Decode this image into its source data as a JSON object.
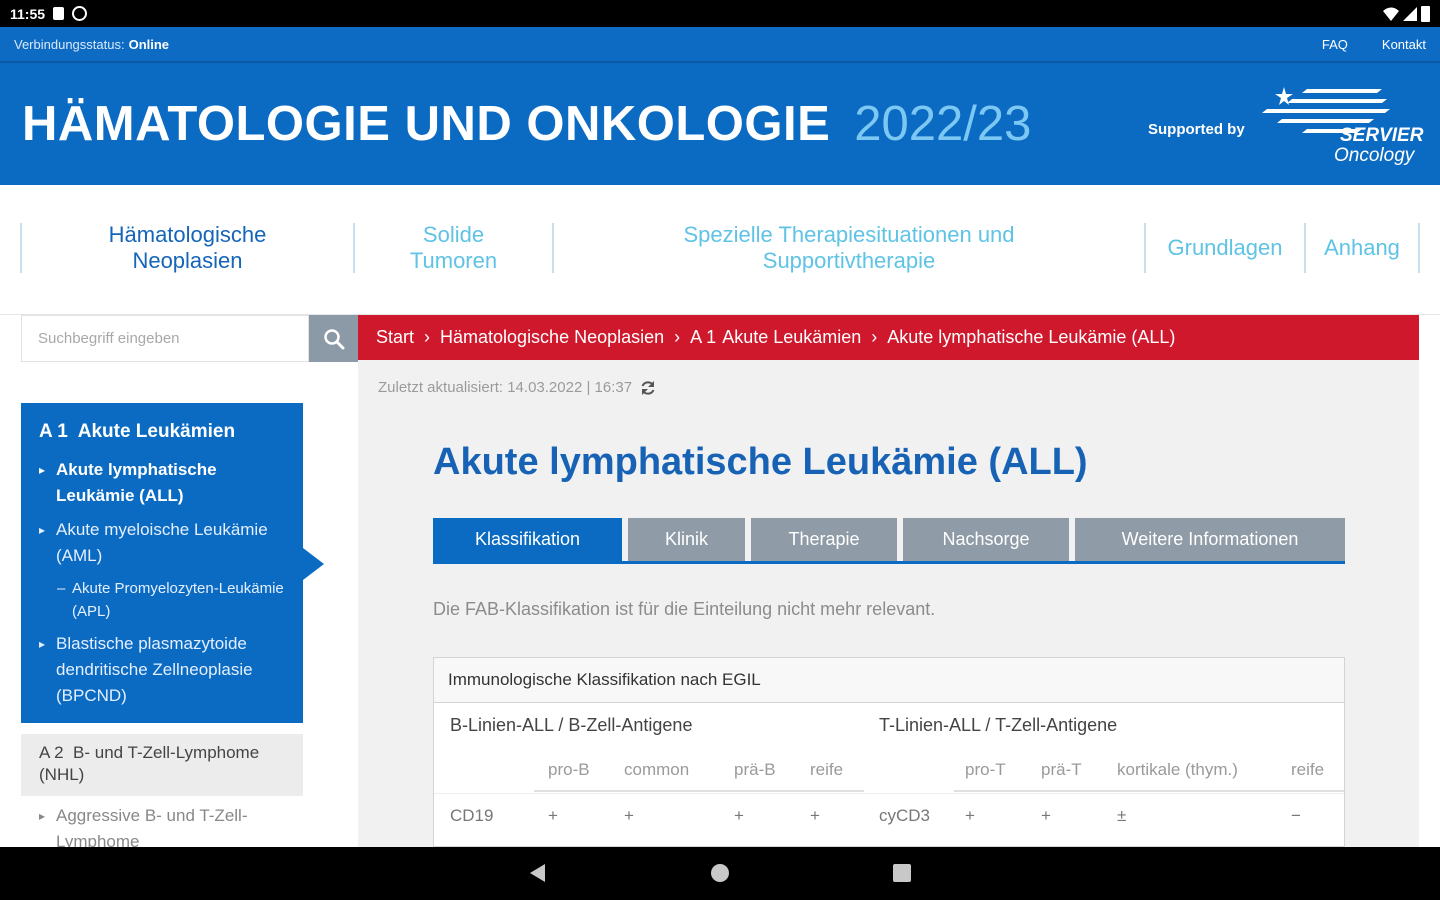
{
  "status_bar": {
    "time": "11:55"
  },
  "connection": {
    "label": "Verbindungsstatus:",
    "status": "Online",
    "faq": "FAQ",
    "contact": "Kontakt"
  },
  "header": {
    "title": "HÄMATOLOGIE UND ONKOLOGIE",
    "year": "2022/23",
    "supported_by": "Supported by",
    "logo_text_1": "SERVIER",
    "logo_text_2": "Oncology"
  },
  "nav": [
    {
      "line1": "Hämatologische",
      "line2": "Neoplasien"
    },
    {
      "line1": "Solide",
      "line2": "Tumoren"
    },
    {
      "line1": "Spezielle Therapiesituationen und",
      "line2": "Supportivtherapie"
    },
    {
      "line1": "Grundlagen",
      "line2": ""
    },
    {
      "line1": "Anhang",
      "line2": ""
    }
  ],
  "search": {
    "placeholder": "Suchbegriff eingeben"
  },
  "sidebar": {
    "heading_num": "A 1",
    "heading": "Akute Leukämien",
    "items": [
      {
        "label": "Akute lymphatische Leukämie (ALL)"
      },
      {
        "label": "Akute myeloische Leukämie (AML)"
      },
      {
        "label": "Akute Promyelozyten-Leukämie (APL)"
      },
      {
        "label": "Blastische plasmazytoide dendritische Zellneoplasie (BPCND)"
      }
    ],
    "a2_num": "A 2",
    "a2_label": "B- und T-Zell-Lymphome (NHL)",
    "more": "Aggressive B- und T-Zell-Lymphome"
  },
  "breadcrumb": [
    "Start",
    "Hämatologische Neoplasien",
    "A 1",
    "Akute Leukämien",
    "Akute lymphatische Leukämie (ALL)"
  ],
  "updated": "Zuletzt aktualisiert: 14.03.2022 | 16:37",
  "page_title": "Akute lymphatische Leukämie (ALL)",
  "tabs": [
    "Klassifikation",
    "Klinik",
    "Therapie",
    "Nachsorge",
    "Weitere Informationen"
  ],
  "description": "Die FAB-Klassifikation ist für die Einteilung nicht mehr relevant.",
  "table": {
    "caption": "Immunologische Klassifikation nach EGIL",
    "group_b": "B-Linien-ALL / B-Zell-Antigene",
    "group_t": "T-Linien-ALL / T-Zell-Antigene",
    "cols_b": [
      "pro-B",
      "common",
      "prä-B",
      "reife"
    ],
    "cols_t": [
      "pro-T",
      "prä-T",
      "kortikale (thym.)",
      "reife"
    ],
    "row": {
      "b_marker": "CD19",
      "b_values": [
        "+",
        "+",
        "+",
        "+"
      ],
      "t_marker": "cyCD3",
      "t_values": [
        "+",
        "+",
        "±",
        "−"
      ]
    }
  }
}
